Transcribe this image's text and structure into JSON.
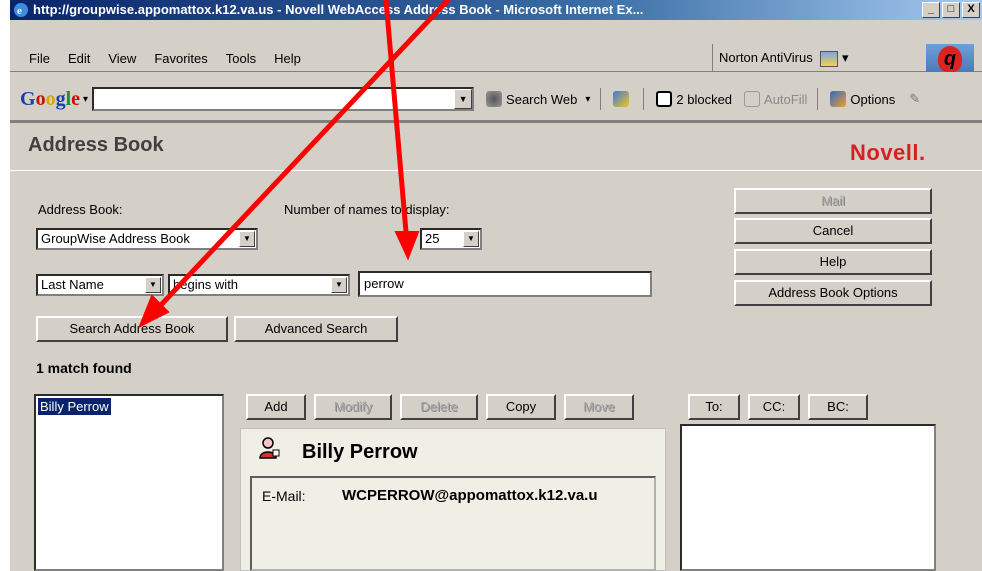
{
  "window": {
    "title": "http://groupwise.appomattox.k12.va.us - Novell WebAccess Address Book - Microsoft Internet Ex...",
    "controls": [
      "_",
      "□",
      "X"
    ]
  },
  "menu": {
    "items": [
      "File",
      "Edit",
      "View",
      "Favorites",
      "Tools",
      "Help"
    ],
    "norton": "Norton AntiVirus"
  },
  "google_toolbar": {
    "logo": "Google",
    "search_web": "Search Web",
    "blocked": "2 blocked",
    "autofill": "AutoFill",
    "options": "Options"
  },
  "app": {
    "title": "Address Book",
    "brand": "Novell.",
    "address_book_label": "Address Book:",
    "address_book_value": "GroupWise Address Book",
    "names_to_display_label": "Number of names to display:",
    "names_to_display_value": "25",
    "field_value": "Last Name",
    "operator_value": "begins with",
    "search_text": "perrow",
    "search_button": "Search Address Book",
    "advanced_button": "Advanced Search",
    "side_buttons": {
      "mail": "Mail",
      "cancel": "Cancel",
      "help": "Help",
      "options": "Address Book Options"
    },
    "match_text": "1 match found",
    "results": [
      "Billy Perrow"
    ],
    "action_buttons": {
      "add": "Add",
      "modify": "Modify",
      "delete": "Delete",
      "copy": "Copy",
      "move": "Move"
    },
    "recipient_buttons": {
      "to": "To:",
      "cc": "CC:",
      "bc": "BC:"
    },
    "detail": {
      "name": "Billy Perrow",
      "email_label": "E-Mail:",
      "email_value": "WCPERROW@appomattox.k12.va.u"
    }
  },
  "colors": {
    "titlebar": "#0a246a",
    "brand": "#d42020",
    "annotation_arrow": "#ff0000"
  }
}
